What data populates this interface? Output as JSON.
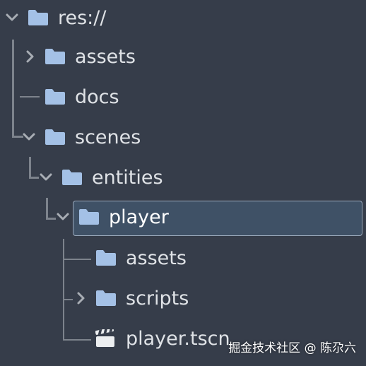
{
  "panel": "filesystem",
  "items": [
    {
      "label": "res://",
      "icon": "folder-icon",
      "expander": "expanded"
    },
    {
      "label": "assets",
      "icon": "folder-icon",
      "expander": "collapsed"
    },
    {
      "label": "docs",
      "icon": "folder-icon",
      "expander": "none"
    },
    {
      "label": "scenes",
      "icon": "folder-icon",
      "expander": "expanded"
    },
    {
      "label": "entities",
      "icon": "folder-icon",
      "expander": "expanded"
    },
    {
      "label": "player",
      "icon": "folder-icon",
      "expander": "expanded",
      "selected": true
    },
    {
      "label": "assets",
      "icon": "folder-icon",
      "expander": "none"
    },
    {
      "label": "scripts",
      "icon": "folder-icon",
      "expander": "collapsed"
    },
    {
      "label": "player.tscn",
      "icon": "clapperboard-icon",
      "expander": "none"
    }
  ],
  "watermark": "掘金技术社区 @ 陈尕六",
  "colors": {
    "background": "#363d4a",
    "folder": "#a4c1e6",
    "text": "#dfe2e6",
    "guide_line": "#7d838c",
    "arrow": "#a8adb4",
    "selection_bg": "#3f5166",
    "selection_border": "#9aa9bb"
  }
}
